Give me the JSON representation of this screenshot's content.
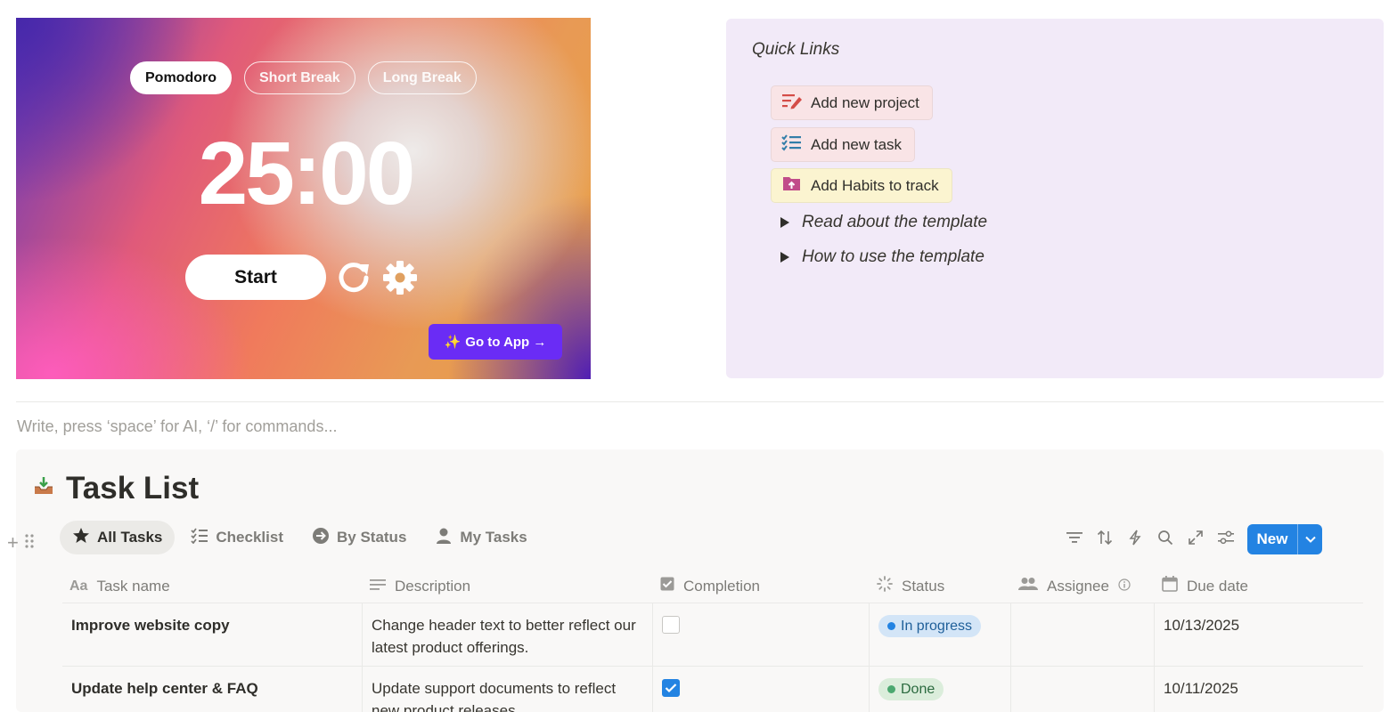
{
  "pomodoro": {
    "tabs": [
      "Pomodoro",
      "Short Break",
      "Long Break"
    ],
    "time": "25:00",
    "start_label": "Start",
    "go_to_app_label": "Go to App →",
    "go_to_app_sparkle": "✨"
  },
  "quick_links": {
    "title": "Quick Links",
    "buttons": [
      {
        "label": "Add new project",
        "icon": "edit-list-icon"
      },
      {
        "label": "Add new task",
        "icon": "checklist-icon"
      },
      {
        "label": "Add Habits to track",
        "icon": "folder-upload-icon"
      }
    ],
    "toggles": [
      "Read about the template",
      "How to use the template"
    ]
  },
  "editor": {
    "placeholder": "Write, press ‘space’ for AI, ‘/’ for commands..."
  },
  "database": {
    "title": "Task List",
    "views": [
      "All Tasks",
      "Checklist",
      "By Status",
      "My Tasks"
    ],
    "new_label": "New",
    "columns": [
      "Task name",
      "Description",
      "Completion",
      "Status",
      "Assignee",
      "Due date"
    ],
    "rows": [
      {
        "name": "Improve website copy",
        "description_line1": "Change header text to better reflect our",
        "description_line2": "latest product offerings.",
        "completed": false,
        "status": "In progress",
        "assignee": "",
        "due": "10/13/2025"
      },
      {
        "name": "Update help center & FAQ",
        "description_line1": "Update support documents to reflect",
        "description_line2": "new product releases",
        "completed": true,
        "status": "Done",
        "assignee": "",
        "due": "10/11/2025"
      }
    ]
  },
  "colors": {
    "accent_blue": "#2383e2",
    "go_app_purple": "#6a2cf5",
    "quick_links_bg": "#f2eaf8"
  }
}
